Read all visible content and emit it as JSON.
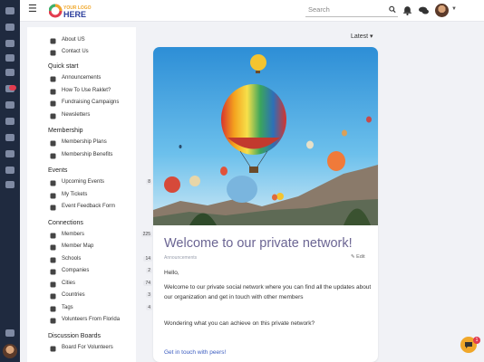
{
  "logo": {
    "text_top": "YOUR LOGO",
    "text_main": "HERE"
  },
  "search": {
    "placeholder": "Search"
  },
  "feed": {
    "sort_label": "Latest ▾"
  },
  "sidebar": {
    "top_items": [
      {
        "label": "About US"
      },
      {
        "label": "Contact Us"
      }
    ],
    "sections": [
      {
        "title": "Quick start",
        "items": [
          {
            "label": "Announcements",
            "count": ""
          },
          {
            "label": "How To Use Raklet?",
            "count": ""
          },
          {
            "label": "Fundraising Campaigns",
            "count": ""
          },
          {
            "label": "Newsletters",
            "count": ""
          }
        ]
      },
      {
        "title": "Membership",
        "items": [
          {
            "label": "Membership Plans",
            "count": ""
          },
          {
            "label": "Membership Benefits",
            "count": ""
          }
        ]
      },
      {
        "title": "Events",
        "items": [
          {
            "label": "Upcoming Events",
            "count": "8"
          },
          {
            "label": "My Tickets",
            "count": ""
          },
          {
            "label": "Event Feedback Form",
            "count": ""
          }
        ]
      },
      {
        "title": "Connections",
        "items": [
          {
            "label": "Members",
            "count": "225"
          },
          {
            "label": "Member Map",
            "count": ""
          },
          {
            "label": "Schools",
            "count": "14"
          },
          {
            "label": "Companies",
            "count": "2"
          },
          {
            "label": "Cities",
            "count": "74"
          },
          {
            "label": "Countries",
            "count": "3"
          },
          {
            "label": "Tags",
            "count": "4"
          },
          {
            "label": "Volunteers From Florida",
            "count": ""
          }
        ]
      },
      {
        "title": "Discussion Boards",
        "items": [
          {
            "label": "Board For Volunteers",
            "count": ""
          }
        ]
      }
    ]
  },
  "post": {
    "title": "Welcome to our private network!",
    "category": "Announcements",
    "edit_label": "Edit",
    "greeting": "Hello,",
    "paragraph1": "Welcome to our private social network where you can find all the updates about our organization and get in touch with other members",
    "paragraph2": "Wondering what you can achieve on this private network?",
    "link": "Get in touch with peers!"
  },
  "chat_badge": "1",
  "colors": {
    "rail": "#1f2a3f",
    "title": "#6b6593",
    "link": "#3b5cc0",
    "chat": "#f0a72a"
  }
}
